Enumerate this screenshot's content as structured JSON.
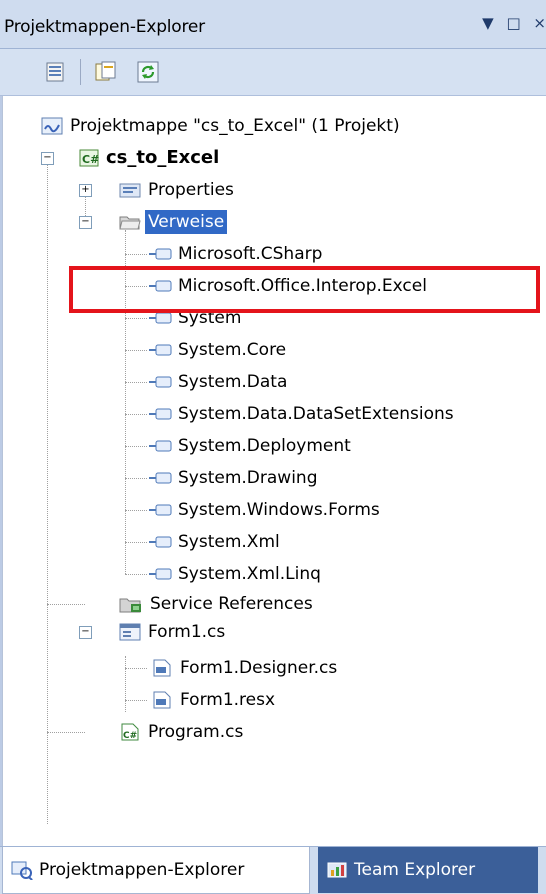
{
  "window": {
    "title": "Projektmappen-Explorer",
    "controls": [
      "▼",
      "□",
      "×"
    ]
  },
  "toolbar": {
    "buttons": [
      "properties-icon",
      "show-all-files-icon",
      "refresh-icon"
    ]
  },
  "tree": {
    "solution": "Projektmappe \"cs_to_Excel\" (1 Projekt)",
    "project": "cs_to_Excel",
    "properties": "Properties",
    "references": "Verweise",
    "reference_items": [
      "Microsoft.CSharp",
      "Microsoft.Office.Interop.Excel",
      "System",
      "System.Core",
      "System.Data",
      "System.Data.DataSetExtensions",
      "System.Deployment",
      "System.Drawing",
      "System.Windows.Forms",
      "System.Xml",
      "System.Xml.Linq"
    ],
    "service_references": "Service References",
    "form": "Form1.cs",
    "form_children": [
      "Form1.Designer.cs",
      "Form1.resx"
    ],
    "program": "Program.cs"
  },
  "tabs": {
    "solution_explorer": "Projektmappen-Explorer",
    "team_explorer": "Team Explorer"
  },
  "colors": {
    "highlight": "#e4141b",
    "selection": "#3169c6"
  }
}
